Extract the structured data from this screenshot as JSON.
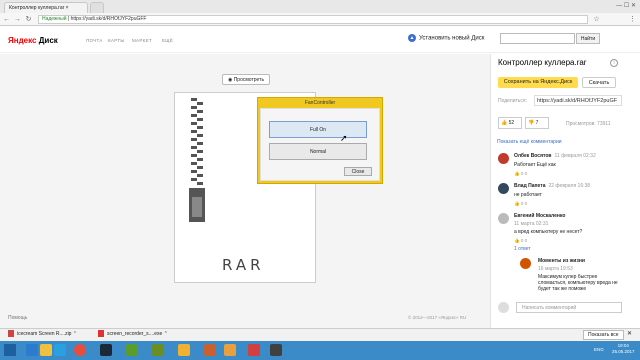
{
  "browser": {
    "tab_title": "Контроллер куллера.rar",
    "tab_new": "",
    "secure_label": "Надежный",
    "url": "https://yadi.sk/d/RHOfJYF2puGFF",
    "user_label": "",
    "icons": [
      "back-icon",
      "forward-icon",
      "reload-icon",
      "star-icon",
      "menu-icon"
    ]
  },
  "header": {
    "logo_main": "Яндекс",
    "logo_sub": "Диск",
    "nav": [
      "ПОЧТА",
      "КАРТЫ",
      "МАРКЕТ",
      "ЕЩЁ"
    ],
    "install_label": "Установить новый Диск",
    "search_placeholder": "",
    "search_button": "Найти"
  },
  "viewer": {
    "preview_button": "Просмотреть",
    "rar_label": "RAR",
    "dialog": {
      "title": "FanController",
      "fullon": "Full On",
      "normal": "Normal",
      "close": "Close"
    },
    "help": "Помощь",
    "copyright": "© 2012—2017 «Яндекс»  RU"
  },
  "panel": {
    "filename": "Контроллер куллера.rar",
    "save_button": "Сохранить на Яндекс.Диск",
    "download_button": "Скачать",
    "share_label": "Поделиться:",
    "share_url": "https://yadi.sk/d/RHOfJYF2puGF",
    "likes": "52",
    "dislikes": "7",
    "views": "Просмотров: 73911",
    "show_more": "Показать ещё комментарии",
    "comments": [
      {
        "name": "Олбек Восятов",
        "date": "11 февраля 02:32",
        "text": "Работает Ещё как",
        "votes": "0    0",
        "avatar_color": "#c0392b"
      },
      {
        "name": "Влад Папета",
        "date": "22 февраля 16:38",
        "text": "не работает",
        "votes": "0    0",
        "avatar_color": "#34495e"
      },
      {
        "name": "Евгений Москаленко",
        "date": "11 марта 02:31",
        "text": "а вред компьютеру не несет?",
        "votes": "0    0",
        "reply": "1 ответ",
        "avatar_color": "#bbbbbb"
      },
      {
        "name": "Моменты из жизни",
        "date": "16 марта 19:53",
        "text": "Максимум кулер быстрее сломається, компьютеру вреда не будет так же поможе",
        "votes": "",
        "avatar_color": "#d35400"
      }
    ],
    "comment_placeholder": "Написать комментарий"
  },
  "downloads": {
    "items": [
      "icecream Screen R....zip",
      "screen_recorder_s....exe"
    ],
    "show_all": "Показать все"
  },
  "taskbar": {
    "lang": "ENG",
    "time": "19:04",
    "date": "25.05.2017",
    "icons": [
      "ie-icon",
      "explorer-icon",
      "media-icon",
      "chrome-icon",
      "steam-icon",
      "utorrent-icon",
      "minecraft-icon",
      "folder-icon",
      "gear-icon",
      "paint-icon",
      "browser-icon",
      "app-icon"
    ]
  },
  "colors": {
    "accent": "#ffdb4d",
    "dialog": "#f0c820",
    "taskbar": "#3a8bc7",
    "link": "#3a6fc4"
  }
}
